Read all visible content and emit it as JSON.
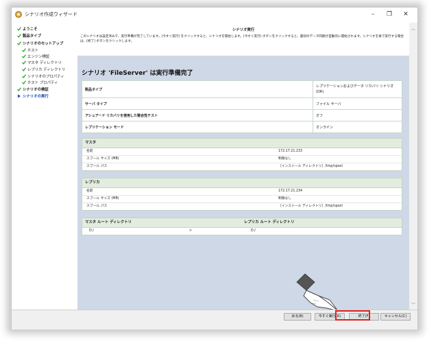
{
  "window": {
    "title": "シナリオ作成ウィザード",
    "controls": {
      "minimize": "–",
      "maximize": "❐",
      "close": "✕"
    }
  },
  "sidebar": {
    "items": [
      {
        "label": "ようこそ",
        "level": 0,
        "done": true
      },
      {
        "label": "製品タイプ",
        "level": 0,
        "done": true
      },
      {
        "label": "シナリオのセットアップ",
        "level": 0,
        "done": true
      },
      {
        "label": "ホスト",
        "level": 1,
        "done": true
      },
      {
        "label": "エンジン検証",
        "level": 1,
        "done": true
      },
      {
        "label": "マスタ ディレクトリ",
        "level": 1,
        "done": true
      },
      {
        "label": "レプリカ ディレクトリ",
        "level": 1,
        "done": true
      },
      {
        "label": "シナリオのプロパティ",
        "level": 1,
        "done": true
      },
      {
        "label": "ホスト プロパティ",
        "level": 1,
        "done": true
      },
      {
        "label": "シナリオの検証",
        "level": 0,
        "done": true
      },
      {
        "label": "シナリオの実行",
        "level": 0,
        "done": false,
        "current": true
      }
    ]
  },
  "header": {
    "title": "シナリオ実行",
    "description": "このシナリオは設定済みで、実行準備が完了しています。[今すぐ実行] をクリックすると、シナリオを開始します。[今すぐ実行] ボタンをクリックすると、最初のデータ同期が自動的に開始されます。シナリオを後で実行する場合は、[終了] ボタンをクリックします。"
  },
  "main": {
    "title": "シナリオ 'FileServer' は実行準備完了",
    "summary": [
      {
        "key": "製品タイプ",
        "value": "レプリケーションおよびデータ リカバリ シナリオ (DR)"
      },
      {
        "key": "サーバ タイプ",
        "value": "ファイル サーバ"
      },
      {
        "key": "アシュアード リカバリを使用した整合性テスト",
        "value": "オフ"
      },
      {
        "key": "レプリケーション モード",
        "value": "オンライン"
      }
    ],
    "master": {
      "heading": "マスタ",
      "rows": [
        {
          "key": "名前",
          "value": "172.17.21.233"
        },
        {
          "key": "スプール サイズ (MB)",
          "value": "制限なし"
        },
        {
          "key": "スプール パス",
          "value": "［インストール ディレクトリ］/tmp/spool"
        }
      ]
    },
    "replica": {
      "heading": "レプリカ",
      "rows": [
        {
          "key": "名前",
          "value": "172.17.21.234"
        },
        {
          "key": "スプール サイズ (MB)",
          "value": "制限なし"
        },
        {
          "key": "スプール パス",
          "value": "［インストール ディレクトリ］/tmp/spool"
        }
      ]
    },
    "directories": {
      "master_header": "マスタ ルート ディレクトリ",
      "replica_header": "レプリカ ルート ディレクトリ",
      "master_value": "D:/",
      "arrow": ">",
      "replica_value": "D:/"
    }
  },
  "footer": {
    "back": "戻る(B)",
    "run_now": "今すぐ実行(R)",
    "finish": "終了(F)",
    "cancel": "キャンセル(C)"
  },
  "colors": {
    "accent": "#1a48b0",
    "highlight": "#e02020",
    "section_header": "#e2ecdf",
    "content_bg": "#cfd8e6"
  }
}
